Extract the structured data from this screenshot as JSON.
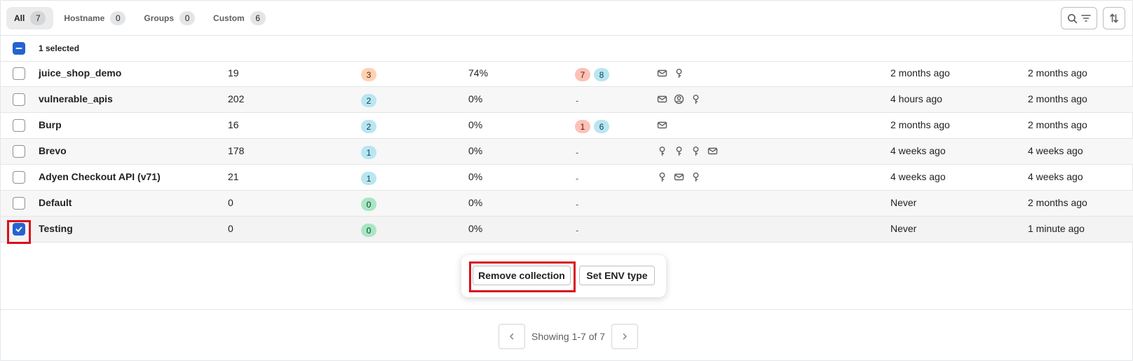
{
  "tabs": [
    {
      "label": "All",
      "count": "7"
    },
    {
      "label": "Hostname",
      "count": "0"
    },
    {
      "label": "Groups",
      "count": "0"
    },
    {
      "label": "Custom",
      "count": "6"
    }
  ],
  "toolbar": {
    "search_icon": "search-icon",
    "filter_icon": "filter-icon",
    "sort_icon": "sort-icon"
  },
  "selection": {
    "text": "1 selected"
  },
  "rows": [
    {
      "name": "juice_shop_demo",
      "endpoints": "19",
      "risk": "3",
      "risk_color": "orange",
      "coverage": "74%",
      "issues": [
        "7",
        "8"
      ],
      "sensitive": [
        "mail",
        "key"
      ],
      "discovered": "2 months ago",
      "last_traffic": "2 months ago"
    },
    {
      "name": "vulnerable_apis",
      "endpoints": "202",
      "risk": "2",
      "risk_color": "blue",
      "coverage": "0%",
      "issues_text": "-",
      "sensitive": [
        "mail",
        "user",
        "key"
      ],
      "discovered": "4 hours ago",
      "last_traffic": "2 months ago"
    },
    {
      "name": "Burp",
      "endpoints": "16",
      "risk": "2",
      "risk_color": "blue",
      "coverage": "0%",
      "issues": [
        "1",
        "6"
      ],
      "sensitive": [
        "mail"
      ],
      "discovered": "2 months ago",
      "last_traffic": "2 months ago"
    },
    {
      "name": "Brevo",
      "endpoints": "178",
      "risk": "1",
      "risk_color": "blue",
      "coverage": "0%",
      "issues_text": "-",
      "sensitive": [
        "key",
        "key",
        "key",
        "mail"
      ],
      "discovered": "4 weeks ago",
      "last_traffic": "4 weeks ago"
    },
    {
      "name": "Adyen Checkout API (v71)",
      "endpoints": "21",
      "risk": "1",
      "risk_color": "blue",
      "coverage": "0%",
      "issues_text": "-",
      "sensitive": [
        "key",
        "mail",
        "key"
      ],
      "discovered": "4 weeks ago",
      "last_traffic": "4 weeks ago"
    },
    {
      "name": "Default",
      "endpoints": "0",
      "risk": "0",
      "risk_color": "green",
      "coverage": "0%",
      "issues_text": "-",
      "sensitive": [],
      "discovered": "Never",
      "last_traffic": "2 months ago"
    },
    {
      "name": "Testing",
      "endpoints": "0",
      "risk": "0",
      "risk_color": "green",
      "coverage": "0%",
      "issues_text": "-",
      "sensitive": [],
      "discovered": "Never",
      "last_traffic": "1 minute ago",
      "selected": true
    }
  ],
  "actions": {
    "remove": "Remove collection",
    "set_env": "Set ENV type"
  },
  "pagination": {
    "text": "Showing 1-7 of 7"
  },
  "colors": {
    "accent": "#2463d1",
    "highlight": "#d9101b"
  }
}
